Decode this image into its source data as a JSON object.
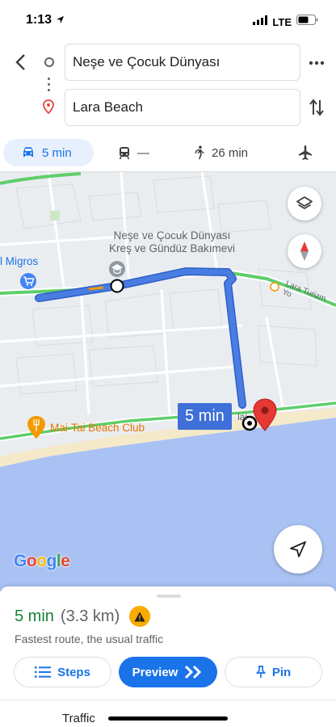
{
  "status_bar": {
    "time": "1:13",
    "network": "LTE"
  },
  "route": {
    "origin": "Neşe ve Çocuk Dünyası",
    "destination": "Lara Beach"
  },
  "modes": {
    "drive": "5 min",
    "transit": "—",
    "walk": "26 min"
  },
  "map": {
    "poi_line1": "Neşe ve Çocuk Dünyası",
    "poi_line2": "Kreş ve Gündüz Bakımevi",
    "migros_label": "l Migros",
    "maitai_label": "Mai-Tai Beach Club",
    "road_label": "Lara Turizm Yo",
    "partial_label": "lai",
    "route_badge": "5 min",
    "google_logo": "Google",
    "colors": {
      "route": "#4a7de2",
      "sea": "#a9c2f3",
      "sand": "#f4e9c9",
      "road_traffic": "#5fce6b",
      "pin": "#e53935"
    }
  },
  "sheet": {
    "time": "5 min",
    "distance": "(3.3 km)",
    "description": "Fastest route, the usual traffic",
    "steps_label": "Steps",
    "preview_label": "Preview",
    "pin_label": "Pin"
  },
  "bottom_bar": {
    "traffic_label": "Traffic"
  }
}
